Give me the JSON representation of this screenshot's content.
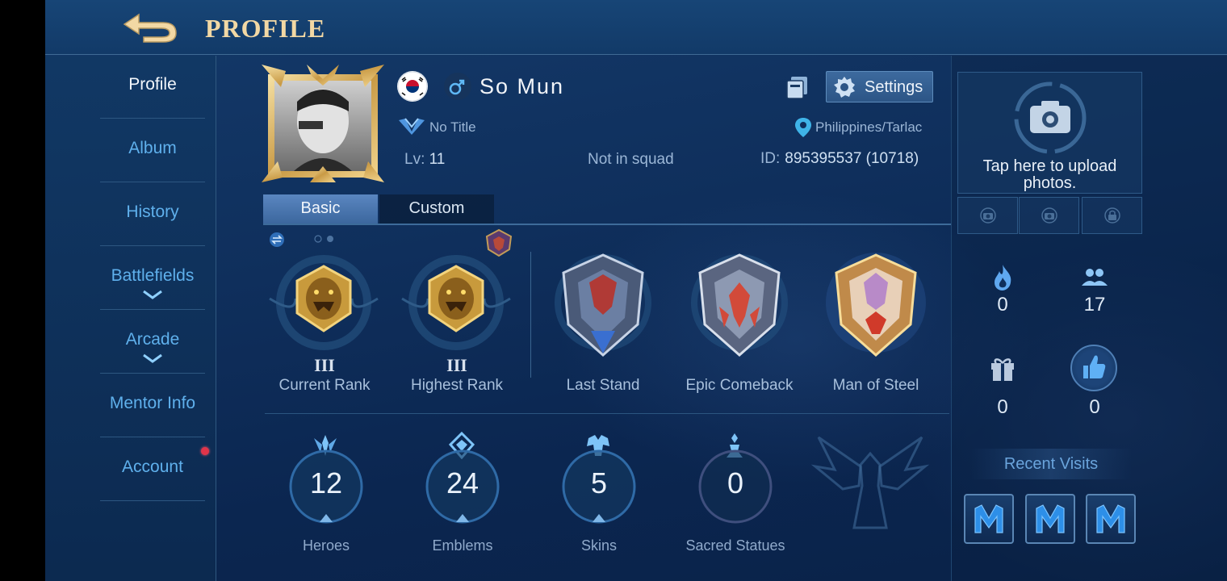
{
  "header": {
    "title": "PROFILE"
  },
  "sidebar": {
    "items": [
      {
        "label": "Profile",
        "active": true
      },
      {
        "label": "Album"
      },
      {
        "label": "History"
      },
      {
        "label": "Battlefields",
        "expandable": true
      },
      {
        "label": "Arcade",
        "expandable": true
      },
      {
        "label": "Mentor Info"
      },
      {
        "label": "Account",
        "notification": true
      }
    ]
  },
  "profile": {
    "name": "So Mun",
    "title": "No Title",
    "level_label": "Lv:",
    "level_value": "11",
    "squad": "Not in squad",
    "id_label": "ID:",
    "id_value": "895395537 (10718)",
    "location": "Philippines/Tarlac",
    "flag": "south-korea-flag-icon",
    "gender": "male-icon",
    "settings_label": "Settings"
  },
  "tabs": [
    {
      "label": "Basic",
      "active": true
    },
    {
      "label": "Custom",
      "active": false
    }
  ],
  "ranks": [
    {
      "tier": "III",
      "label": "Current Rank"
    },
    {
      "tier": "III",
      "label": "Highest Rank"
    }
  ],
  "achievements": [
    {
      "label": "Last Stand"
    },
    {
      "label": "Epic Comeback"
    },
    {
      "label": "Man of Steel"
    }
  ],
  "stats": [
    {
      "value": "12",
      "label": "Heroes",
      "icon": "heroes-icon"
    },
    {
      "value": "24",
      "label": "Emblems",
      "icon": "emblem-icon"
    },
    {
      "value": "5",
      "label": "Skins",
      "icon": "skin-icon"
    },
    {
      "value": "0",
      "label": "Sacred Statues",
      "icon": "statue-icon"
    }
  ],
  "right_panel": {
    "upload_text": "Tap here to upload photos.",
    "popularity": "0",
    "followers": "17",
    "gifts": "0",
    "likes": "0",
    "recent_title": "Recent Visits"
  },
  "colors": {
    "accent_gold": "#f2d8a4",
    "nav_blue": "#5fb0ec",
    "panel_bg": "#0f2f5c"
  }
}
